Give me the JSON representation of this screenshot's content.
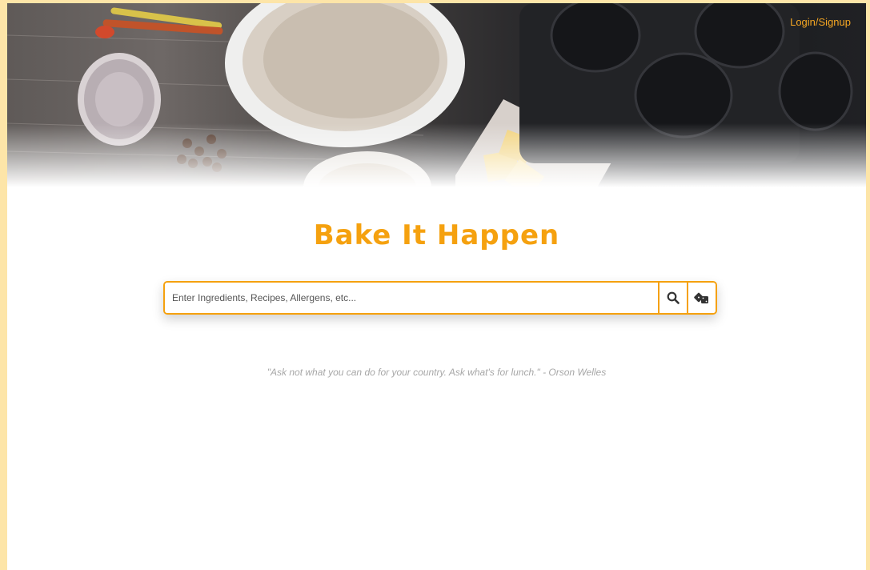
{
  "header": {
    "login_label": "Login/Signup"
  },
  "brand": {
    "title": "Bake It Happen"
  },
  "search": {
    "placeholder": "Enter Ingredients, Recipes, Allergens, etc...",
    "value": "",
    "search_icon": "search-icon",
    "random_icon": "dice-icon"
  },
  "quote": {
    "text": "\"Ask not what you can do for your country. Ask what's for lunch.\" - Orson Welles"
  },
  "colors": {
    "accent": "#f5a10f",
    "page_border": "#fde5a8",
    "quote_text": "#a7a7a7"
  }
}
